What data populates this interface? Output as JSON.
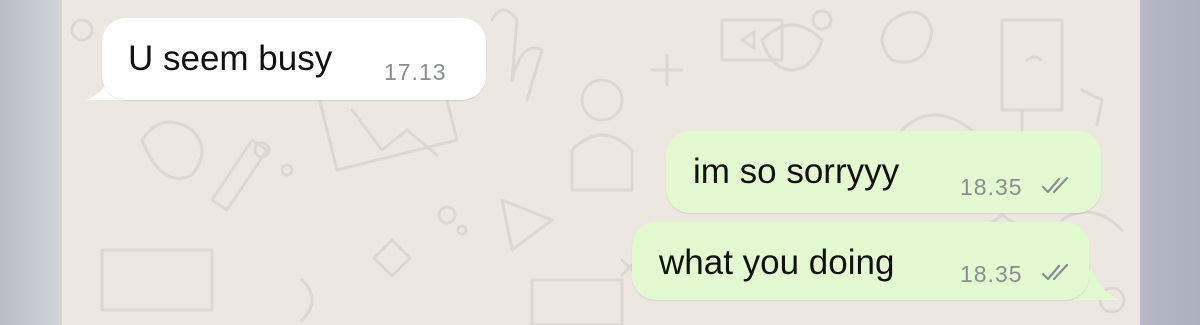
{
  "messages": [
    {
      "direction": "incoming",
      "text": "U seem busy",
      "time": "17.13"
    },
    {
      "direction": "outgoing",
      "text": "im so sorryyy",
      "time": "18.35",
      "status_icon": "double-check-icon"
    },
    {
      "direction": "outgoing",
      "text": "what you doing",
      "time": "18.35",
      "status_icon": "double-check-icon"
    }
  ],
  "colors": {
    "wallpaper": "#ece8e1",
    "incoming_bubble": "#ffffff",
    "outgoing_bubble": "#e3f9cf",
    "timestamp": "#8a8d91",
    "pattern_stroke": "#dcd7cf"
  }
}
